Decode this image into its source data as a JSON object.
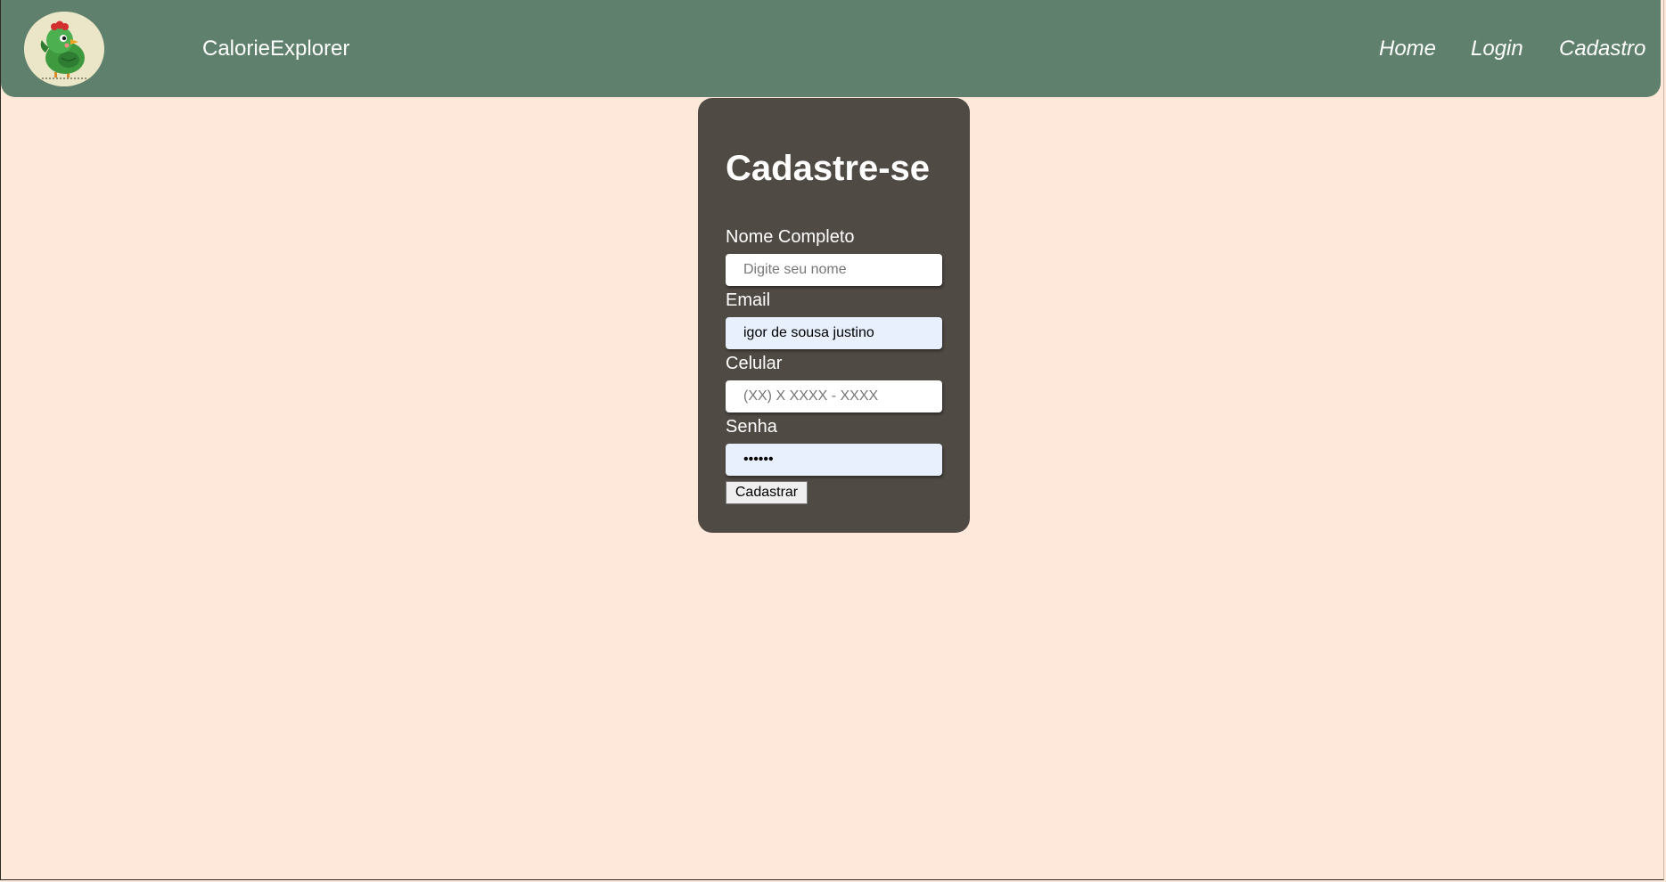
{
  "header": {
    "brand": "CalorieExplorer",
    "nav": {
      "home": "Home",
      "login": "Login",
      "cadastro": "Cadastro"
    },
    "logo_icon": "chicken-logo-icon"
  },
  "form": {
    "title": "Cadastre-se",
    "fields": {
      "name": {
        "label": "Nome Completo",
        "placeholder": "Digite seu nome",
        "value": ""
      },
      "email": {
        "label": "Email",
        "placeholder": "",
        "value": "igor de sousa justino"
      },
      "phone": {
        "label": "Celular",
        "placeholder": "(XX) X XXXX - XXXX",
        "value": ""
      },
      "password": {
        "label": "Senha",
        "placeholder": "",
        "value": "••••••"
      }
    },
    "submit_label": "Cadastrar"
  },
  "colors": {
    "navbar": "#5f806c",
    "background": "#fde8da",
    "card": "#504a44",
    "autofill": "#e8f0fe"
  }
}
